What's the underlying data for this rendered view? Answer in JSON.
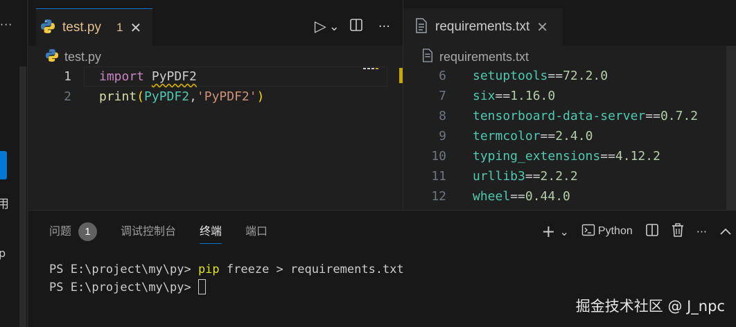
{
  "left_panel": {
    "more_label": "···",
    "cut_label_1": "用",
    "cut_label_2": "p"
  },
  "editor1": {
    "tab": {
      "title": "test.py",
      "badge": "1",
      "close": "✕"
    },
    "actions": {
      "run": "▷",
      "run_menu": "⌄",
      "split": "◫",
      "more": "···"
    },
    "breadcrumb": "test.py",
    "lines": [
      {
        "num": "1",
        "tokens": [
          {
            "t": "import",
            "c": "kw"
          },
          {
            "t": " ",
            "c": "var"
          },
          {
            "t": "PyPDF2",
            "c": "var squig"
          }
        ]
      },
      {
        "num": "2",
        "tokens": [
          {
            "t": "print",
            "c": "fn"
          },
          {
            "t": "(",
            "c": "paren"
          },
          {
            "t": "PyPDF2",
            "c": "cls"
          },
          {
            "t": ",",
            "c": "var"
          },
          {
            "t": "'PyPDF2'",
            "c": "str"
          },
          {
            "t": ")",
            "c": "paren"
          }
        ]
      }
    ]
  },
  "editor2": {
    "tab": {
      "title": "requirements.txt",
      "close": "✕"
    },
    "breadcrumb": "requirements.txt",
    "lines": [
      {
        "num": "6",
        "pkg": "setuptools",
        "op": "==",
        "ver": "72.2.0"
      },
      {
        "num": "7",
        "pkg": "six",
        "op": "==",
        "ver": "1.16.0"
      },
      {
        "num": "8",
        "pkg": "tensorboard-data-server",
        "op": "==",
        "ver": "0.7.2"
      },
      {
        "num": "9",
        "pkg": "termcolor",
        "op": "==",
        "ver": "2.4.0"
      },
      {
        "num": "10",
        "pkg": "typing_extensions",
        "op": "==",
        "ver": "4.12.2"
      },
      {
        "num": "11",
        "pkg": "urllib3",
        "op": "==",
        "ver": "2.2.2"
      },
      {
        "num": "12",
        "pkg": "wheel",
        "op": "==",
        "ver": "0.44.0"
      }
    ]
  },
  "panel": {
    "tabs": {
      "problems": "问题",
      "problems_count": "1",
      "debug": "调试控制台",
      "terminal": "终端",
      "ports": "端口"
    },
    "actions": {
      "add": "+",
      "add_menu": "⌄",
      "shell": "Python",
      "split": "◫",
      "trash": "🗑",
      "more": "···",
      "collapse": "︿"
    },
    "terminal": {
      "line1_prompt": "PS E:\\project\\my\\py> ",
      "line1_cmd": "pip",
      "line1_rest": " freeze > requirements.txt",
      "line2_prompt": "PS E:\\project\\my\\py> "
    }
  },
  "watermark": "掘金技术社区 @ J_npc",
  "colors": {
    "accent": "#0078d4",
    "warning": "#cca700",
    "tab_modified": "#e2c08d"
  }
}
